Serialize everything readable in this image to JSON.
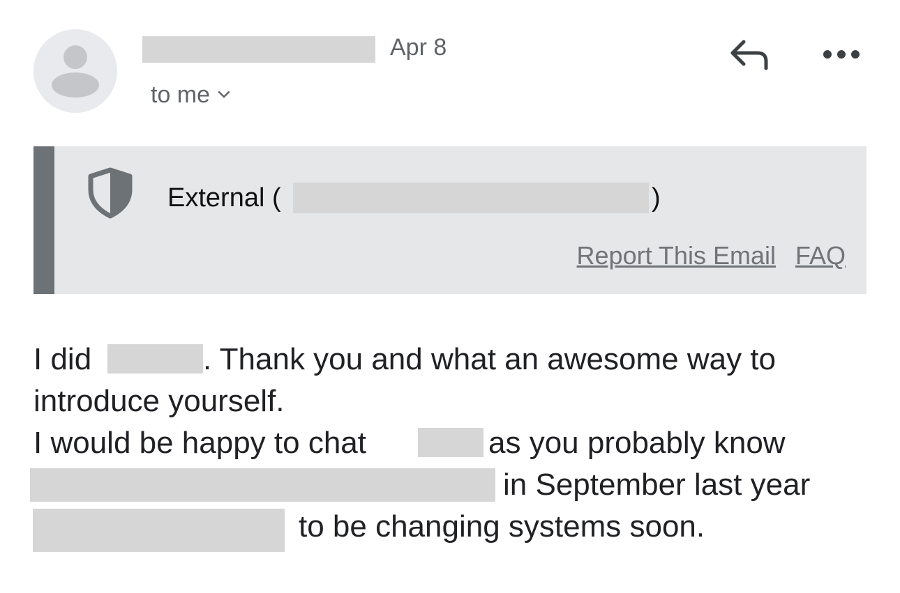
{
  "header": {
    "date": "Apr 8",
    "recipient_label": "to me",
    "avatar_icon": "person-avatar-icon",
    "reply_icon": "reply-icon",
    "more_icon": "more-options-icon",
    "recipient_chevron_icon": "chevron-down-icon"
  },
  "banner": {
    "icon": "shield-icon",
    "label": "External (",
    "close_paren": ")",
    "report_link": "Report This Email",
    "faq_link": "FAQ",
    "accent_color": "#6d7276",
    "background_color": "#e6e7e8"
  },
  "body": {
    "line1_start": "I did",
    "line1_end": ". Thank you and what an awesome way to",
    "line2": "introduce yourself.",
    "line3_start": "I would be happy to chat",
    "line3_end": "as you probably know",
    "line4_end": "in September last year",
    "line5_end": "to be changing systems soon."
  }
}
